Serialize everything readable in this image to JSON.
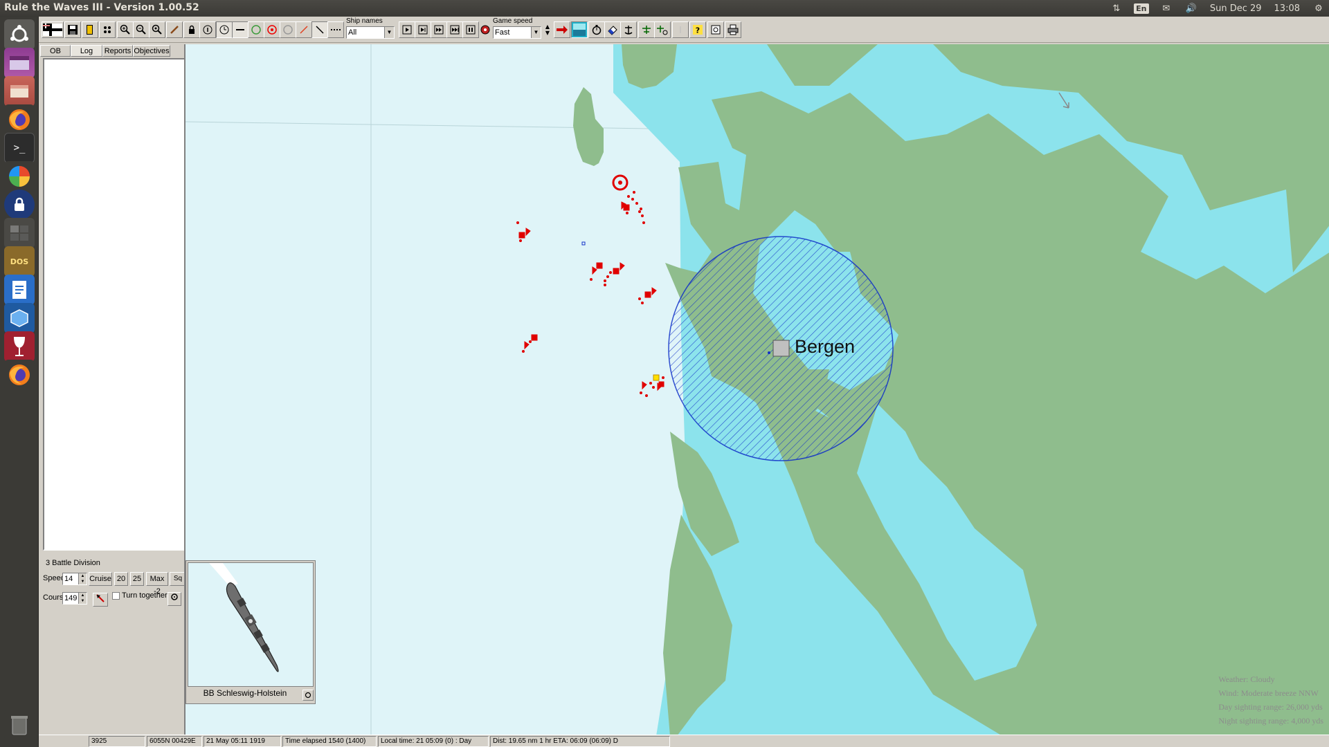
{
  "window": {
    "title": "Rule the Waves III - Version 1.00.52"
  },
  "panel": {
    "lang": "En",
    "date": "Sun Dec 29",
    "time": "13:08"
  },
  "launcher": {
    "items": [
      "ubuntu-dash-icon",
      "files-icon",
      "file-manager-icon",
      "firefox-icon",
      "terminal-icon",
      "app-store-icon",
      "lock-icon",
      "workspace-icon",
      "dosbox-icon",
      "document-viewer-icon",
      "virtualbox-icon",
      "wine-icon",
      "firefox-icon",
      "trash-icon"
    ]
  },
  "toolbar": {
    "ship_names_label": "Ship names",
    "ship_names_value": "All",
    "game_speed_label": "Game speed",
    "game_speed_value": "Fast"
  },
  "left_panel": {
    "tabs": [
      "OB",
      "Log",
      "Reports",
      "Objectives"
    ],
    "active_tab": "Log",
    "division_name": "3 Battle Division",
    "speed_label": "Speed",
    "speed_value": "14",
    "speed_buttons": [
      "Cruise",
      "20",
      "25",
      "Max -2",
      "Sq max"
    ],
    "course_label": "Course",
    "course_value": "149",
    "turn_together_label": "Turn together"
  },
  "ship_thumbnail": {
    "name": "BB Schleswig-Holstein"
  },
  "map": {
    "city": "Bergen",
    "weather": {
      "weather": "Weather: Cloudy",
      "wind": "Wind: Moderate breeze  NNW",
      "day_sighting": "Day sighting range: 26,000 yds",
      "night_sighting": "Night sighting range: 4,000 yds"
    },
    "colors": {
      "sea": "#dff4f8",
      "coastal": "#8ce3ec",
      "land": "#8fbd8d",
      "enemy": "#e00000",
      "zone": "#1030c8"
    }
  },
  "status_bar": {
    "cells": [
      "3925",
      "6055N 00429E",
      "21 May 05:11 1919",
      "Time elapsed 1540 (1400)",
      "Local time: 21 05:09 (0) : Day",
      "Dist: 19.65 nm 1 hr ETA: 06:09 (06:09) D"
    ]
  }
}
